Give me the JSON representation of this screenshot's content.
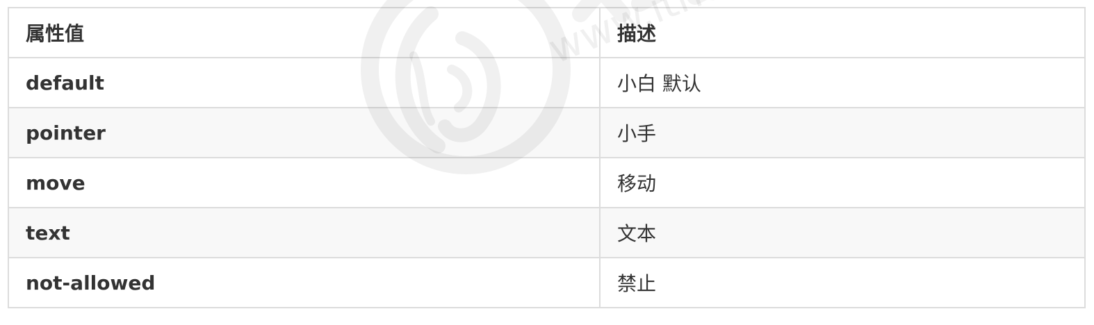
{
  "table": {
    "headers": [
      "属性值",
      "描述"
    ],
    "rows": [
      {
        "value": "default",
        "description": "小白 默认"
      },
      {
        "value": "pointer",
        "description": "小手"
      },
      {
        "value": "move",
        "description": "移动"
      },
      {
        "value": "text",
        "description": "文本"
      },
      {
        "value": "not-allowed",
        "description": "禁止"
      }
    ]
  },
  "watermark": {
    "text": "www.itheima",
    "icon": "seahorse-logo-icon"
  }
}
